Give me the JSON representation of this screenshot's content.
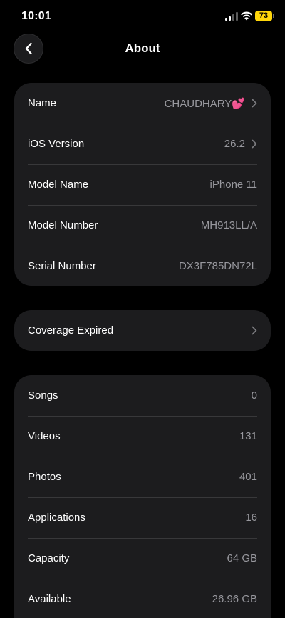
{
  "status_bar": {
    "time": "10:01",
    "battery": "73",
    "battery_color": "#ffd60a"
  },
  "nav": {
    "title": "About",
    "back_icon": "chevron-left-icon"
  },
  "info_section": [
    {
      "label": "Name",
      "value": "CHAUDHARY💕",
      "chevron": true
    },
    {
      "label": "iOS Version",
      "value": "26.2",
      "chevron": true
    },
    {
      "label": "Model Name",
      "value": "iPhone 11",
      "chevron": false
    },
    {
      "label": "Model Number",
      "value": "MH913LL/A",
      "chevron": false
    },
    {
      "label": "Serial Number",
      "value": "DX3F785DN72L",
      "chevron": false
    }
  ],
  "coverage_section": {
    "label": "Coverage Expired",
    "chevron": true
  },
  "stats_section": [
    {
      "label": "Songs",
      "value": "0"
    },
    {
      "label": "Videos",
      "value": "131"
    },
    {
      "label": "Photos",
      "value": "401"
    },
    {
      "label": "Applications",
      "value": "16"
    },
    {
      "label": "Capacity",
      "value": "64 GB"
    },
    {
      "label": "Available",
      "value": "26.96 GB"
    }
  ],
  "colors": {
    "background": "#000000",
    "card": "#1c1c1e",
    "secondary_text": "#98989e",
    "separator": "#38383a"
  }
}
